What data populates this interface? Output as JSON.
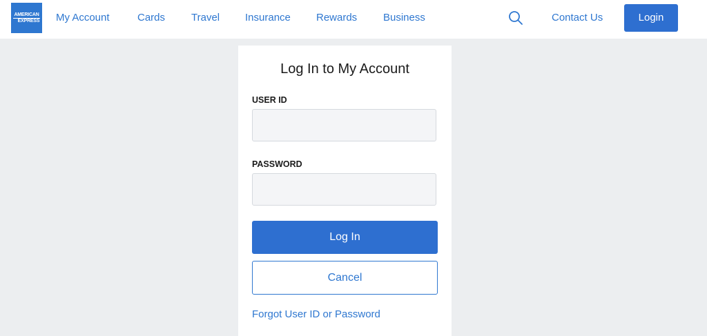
{
  "brand": {
    "logo_line1": "AMERICAN",
    "logo_line2": "EXPRESS",
    "color": "#2e77d0"
  },
  "nav": {
    "items": [
      {
        "label": "My Account"
      },
      {
        "label": "Cards"
      },
      {
        "label": "Travel"
      },
      {
        "label": "Insurance"
      },
      {
        "label": "Rewards"
      },
      {
        "label": "Business"
      }
    ],
    "search_icon": "search-icon",
    "contact_label": "Contact Us",
    "login_label": "Login"
  },
  "login_form": {
    "title": "Log In to My Account",
    "user_id_label": "USER ID",
    "user_id_value": "",
    "password_label": "PASSWORD",
    "password_value": "",
    "submit_label": "Log In",
    "cancel_label": "Cancel",
    "forgot_label": "Forgot User ID or Password"
  },
  "colors": {
    "accent": "#2e6fd0",
    "page_bg": "#eceef0",
    "input_bg": "#f4f5f7"
  }
}
